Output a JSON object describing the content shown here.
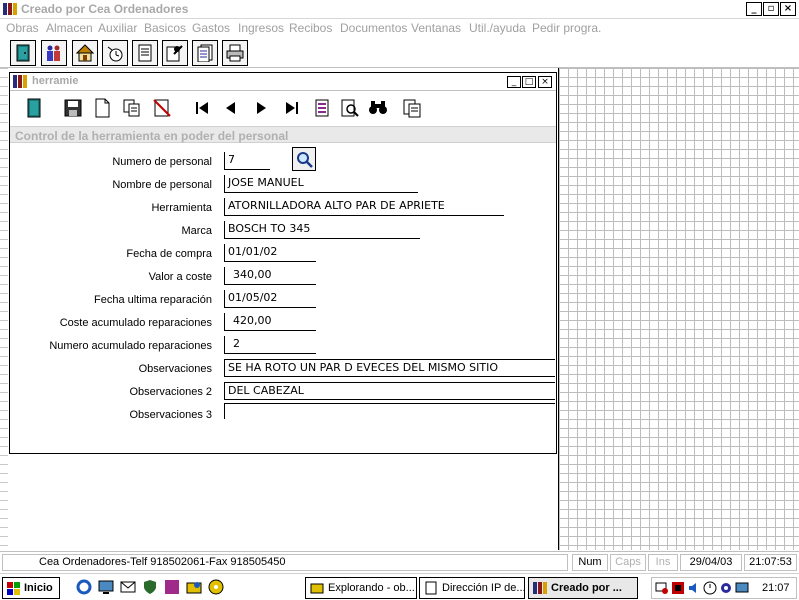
{
  "app": {
    "title": "Creado por Cea Ordenadores",
    "window_buttons": [
      "_",
      "▫",
      "×"
    ]
  },
  "menu": [
    {
      "label": "Obras"
    },
    {
      "label": "Almacen"
    },
    {
      "label": "Auxiliar"
    },
    {
      "label": "Basicos"
    },
    {
      "label": "Gastos"
    },
    {
      "label": "Ingresos"
    },
    {
      "label": "Recibos"
    },
    {
      "label": "Documentos"
    },
    {
      "label": "Ventanas"
    },
    {
      "label": "Util./ayuda"
    },
    {
      "label": "Pedir progra."
    }
  ],
  "child": {
    "title": "herramie",
    "window_buttons": [
      "_",
      "□",
      "×"
    ],
    "header": "Control de la herramienta en poder del personal"
  },
  "form": {
    "fields": [
      {
        "label": "Numero de personal",
        "value": "7"
      },
      {
        "label": "Nombre de personal",
        "value": "JOSE MANUEL"
      },
      {
        "label": "Herramienta",
        "value": "ATORNILLADORA ALTO PAR DE APRIETE"
      },
      {
        "label": "Marca",
        "value": "BOSCH TO 345"
      },
      {
        "label": "Fecha de compra",
        "value": "01/01/02"
      },
      {
        "label": "Valor a coste",
        "value": "340,00"
      },
      {
        "label": "Fecha ultima reparación",
        "value": "01/05/02"
      },
      {
        "label": "Coste acumulado reparaciones",
        "value": "420,00"
      },
      {
        "label": "Numero acumulado reparaciones",
        "value": "2"
      },
      {
        "label": "Observaciones",
        "value": "SE HA ROTO UN PAR D EVECES DEL MISMO SITIO"
      },
      {
        "label": "Observaciones 2",
        "value": "DEL CABEZAL"
      },
      {
        "label": "Observaciones 3",
        "value": ""
      }
    ]
  },
  "status": {
    "company": "Cea Ordenadores-Telf 918502061-Fax 918505450",
    "num": "Num",
    "caps": "Caps",
    "ins": "Ins",
    "date": "29/04/03",
    "time": "21:07:53"
  },
  "taskbar": {
    "start": "Inicio",
    "tasks": [
      {
        "label": "Explorando - ob..."
      },
      {
        "label": "Dirección IP de..."
      },
      {
        "label": "Creado por ..."
      }
    ],
    "clock": "21:07"
  }
}
